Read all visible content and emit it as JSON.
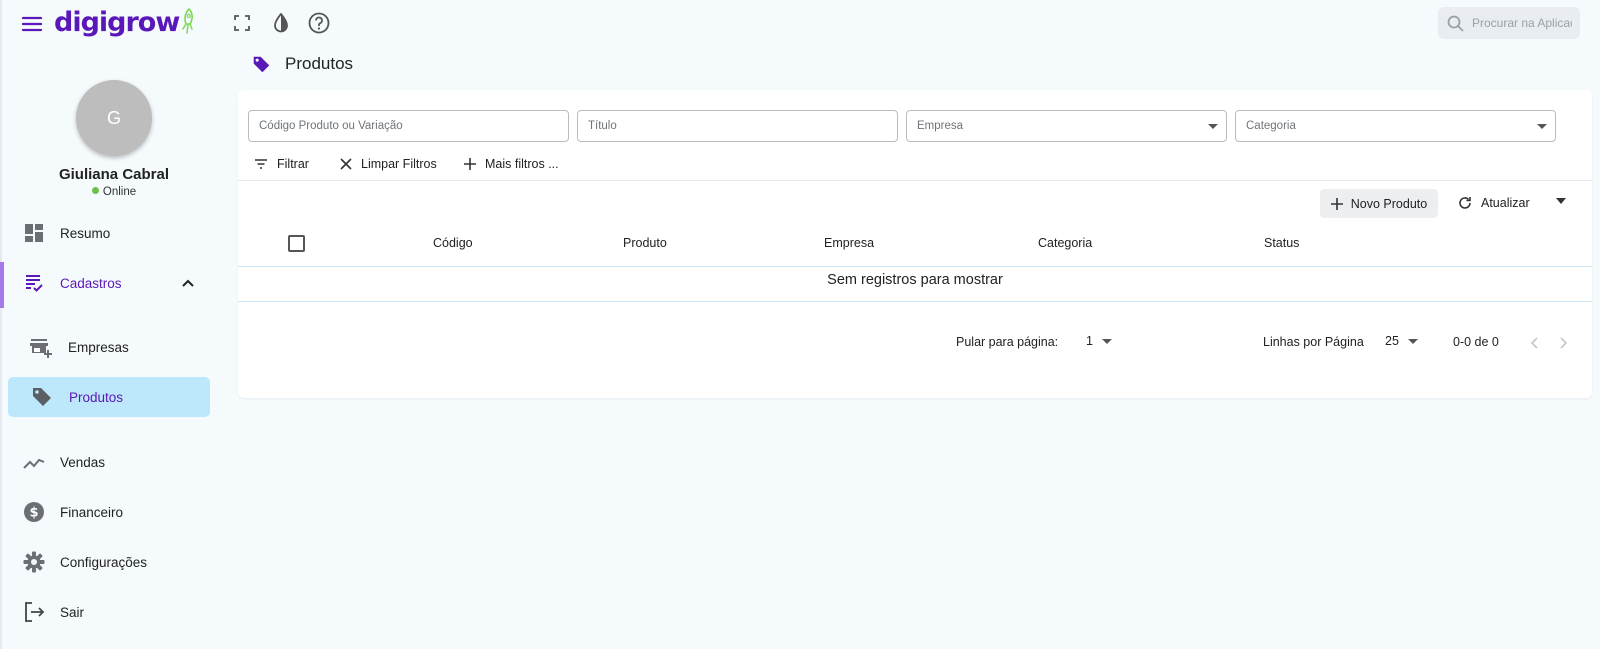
{
  "app": {
    "logo_text": "digigrow",
    "brand_color": "#5a18b8",
    "accent_green": "#7ed957"
  },
  "topbar": {
    "icons": [
      "fullscreen-icon",
      "contrast-icon",
      "help-icon"
    ],
    "search_placeholder": "Procurar na Aplicação"
  },
  "user": {
    "initial": "G",
    "name": "Giuliana Cabral",
    "status": "Online",
    "status_color": "#6cc04a"
  },
  "sidebar": {
    "items": [
      {
        "label": "Resumo",
        "icon": "dashboard-icon"
      },
      {
        "label": "Cadastros",
        "icon": "list-check-icon",
        "expanded": true,
        "children": [
          {
            "label": "Empresas",
            "icon": "store-add-icon"
          },
          {
            "label": "Produtos",
            "icon": "tag-icon",
            "selected": true
          }
        ]
      },
      {
        "label": "Vendas",
        "icon": "trend-icon"
      },
      {
        "label": "Financeiro",
        "icon": "dollar-circle-icon"
      },
      {
        "label": "Configurações",
        "icon": "gear-icon"
      },
      {
        "label": "Sair",
        "icon": "logout-icon"
      }
    ]
  },
  "page": {
    "title": "Produtos",
    "icon": "tag-icon"
  },
  "filters": {
    "fields": [
      {
        "placeholder": "Código Produto ou Variação",
        "type": "text"
      },
      {
        "placeholder": "Título",
        "type": "text"
      },
      {
        "placeholder": "Empresa",
        "type": "select"
      },
      {
        "placeholder": "Categoria",
        "type": "select"
      }
    ],
    "actions": {
      "filter": "Filtrar",
      "clear": "Limpar Filtros",
      "more": "Mais filtros ..."
    }
  },
  "toolbar": {
    "new_label": "Novo Produto",
    "refresh_label": "Atualizar"
  },
  "table": {
    "columns": [
      "Código",
      "Produto",
      "Empresa",
      "Categoria",
      "Status"
    ],
    "rows": [],
    "empty_text": "Sem registros para mostrar"
  },
  "pagination": {
    "jump_label": "Pular para página:",
    "page": "1",
    "rows_label": "Linhas por Página",
    "rows_per_page": "25",
    "range": "0-0 de 0"
  }
}
